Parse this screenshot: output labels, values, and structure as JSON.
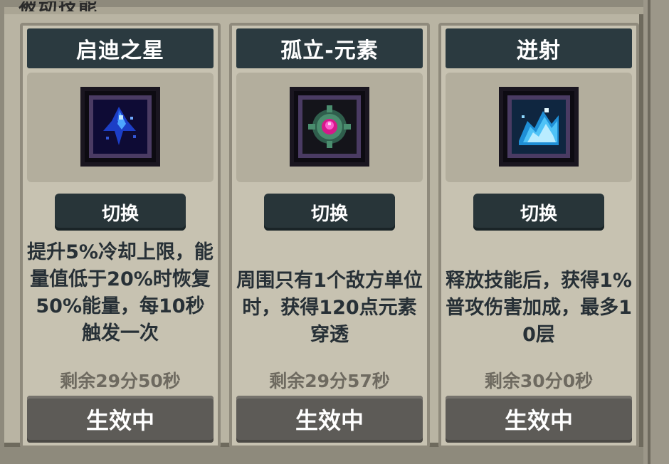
{
  "panel": {
    "title_partial": "被动技能",
    "background_color": "#b9b4a3"
  },
  "cards": [
    {
      "title": "启迪之星",
      "icon": "blue-crystal-star-icon",
      "switch_label": "切换",
      "description": "提升5%冷却上限，能量值低于20%时恢复50%能量，每10秒触发一次",
      "remaining": "剩余29分50秒",
      "status": "生效中"
    },
    {
      "title": "孤立-元素",
      "icon": "green-pink-element-orb-icon",
      "switch_label": "切换",
      "description": "周围只有1个敌方单位时，获得120点元素穿透",
      "remaining": "剩余29分57秒",
      "status": "生效中"
    },
    {
      "title": "迸射",
      "icon": "ice-burst-icon",
      "switch_label": "切换",
      "description": "释放技能后，获得1%普攻伤害加成，最多10层",
      "remaining": "剩余30分0秒",
      "status": "生效中"
    }
  ],
  "colors": {
    "header_bg": "#2b3a40",
    "button_bg": "#283539",
    "status_bg": "#5d5b57",
    "text_dark": "#273036"
  }
}
